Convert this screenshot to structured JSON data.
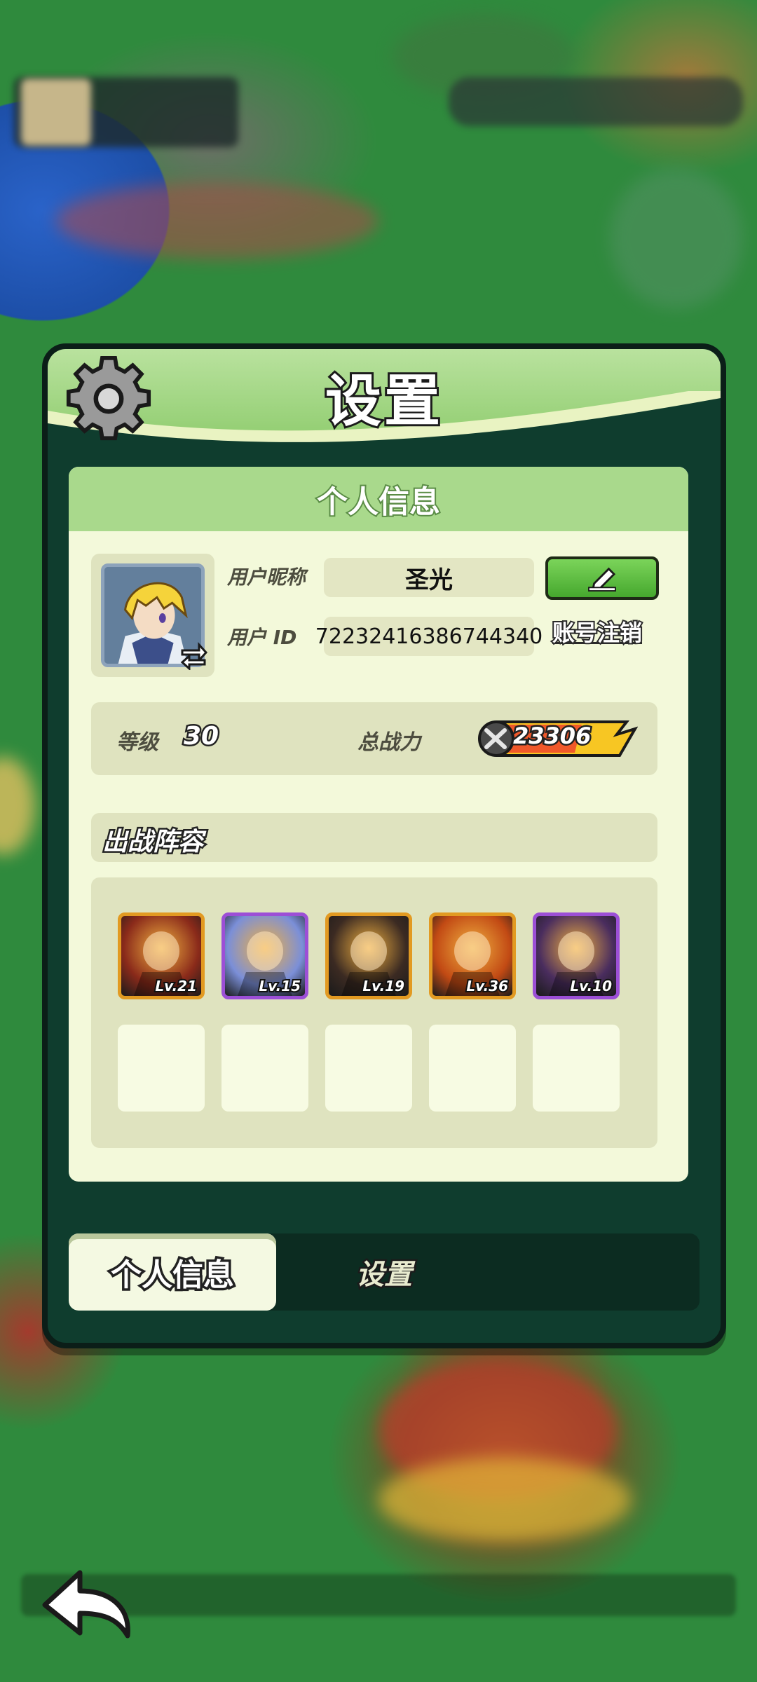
{
  "panel": {
    "title": "设置",
    "section_header": "个人信息"
  },
  "profile": {
    "nickname_label": "用户昵称",
    "nickname_value": "圣光",
    "id_label": "用户 ID",
    "id_value": "72232416386744340",
    "logout_label": "账号注销"
  },
  "stats": {
    "level_label": "等级",
    "level_value": "30",
    "power_label": "总战力",
    "power_value": "23306"
  },
  "lineup": {
    "title": "出战阵容",
    "heroes": [
      {
        "level": "Lv.21",
        "rarity": "gold",
        "color": "#8a2a1a"
      },
      {
        "level": "Lv.15",
        "rarity": "purple",
        "color": "#7b8fd8"
      },
      {
        "level": "Lv.19",
        "rarity": "gold",
        "color": "#3b2a22"
      },
      {
        "level": "Lv.36",
        "rarity": "gold",
        "color": "#c24a14"
      },
      {
        "level": "Lv.10",
        "rarity": "purple",
        "color": "#4a2d5e"
      }
    ],
    "empty_slots": 5
  },
  "tabs": [
    {
      "label": "个人信息",
      "active": true
    },
    {
      "label": "设置",
      "active": false
    }
  ],
  "icons": {
    "gear": "gear-icon",
    "edit": "pencil-icon",
    "swap": "swap-arrows-icon",
    "power": "crossed-swords-icon",
    "back": "back-arrow-icon"
  },
  "colors": {
    "panel_bg": "#0f3d2e",
    "header_green": "#a9d98c",
    "card_bg": "#f3f9da",
    "edit_green": "#46a82e",
    "power_orange": "#f0582a",
    "power_yellow": "#f7c623"
  }
}
